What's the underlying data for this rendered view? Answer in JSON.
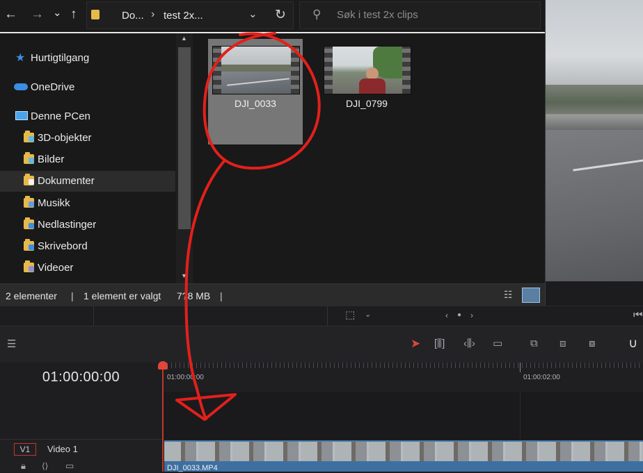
{
  "explorer": {
    "address": {
      "crumbs": [
        "Do...",
        "test 2x..."
      ],
      "separator": "›"
    },
    "search_placeholder": "Søk i test 2x clips",
    "nav": {
      "items": [
        {
          "label": "Hurtigtilgang",
          "icon": "star-icon",
          "level": 0
        },
        {
          "label": "OneDrive",
          "icon": "cloud-icon",
          "level": 0
        },
        {
          "label": "Denne PCen",
          "icon": "computer-icon",
          "level": 0
        },
        {
          "label": "3D-objekter",
          "icon": "folder-3d-icon",
          "level": 1
        },
        {
          "label": "Bilder",
          "icon": "folder-pictures-icon",
          "level": 1
        },
        {
          "label": "Dokumenter",
          "icon": "folder-documents-icon",
          "level": 1,
          "selected": true
        },
        {
          "label": "Musikk",
          "icon": "folder-music-icon",
          "level": 1
        },
        {
          "label": "Nedlastinger",
          "icon": "folder-downloads-icon",
          "level": 1
        },
        {
          "label": "Skrivebord",
          "icon": "folder-desktop-icon",
          "level": 1
        },
        {
          "label": "Videoer",
          "icon": "folder-videos-icon",
          "level": 1
        }
      ]
    },
    "files": [
      {
        "name": "DJI_0033",
        "selected": true
      },
      {
        "name": "DJI_0799",
        "selected": false
      }
    ],
    "status": {
      "count": "2 elementer",
      "selection": "1 element er valgt",
      "size": "7?8 MB"
    }
  },
  "resolve": {
    "timecode": "01:00:00:00",
    "ruler_labels": [
      "01:00:00:00",
      "01:00:02:00"
    ],
    "track": {
      "badge": "V1",
      "name": "Video 1"
    },
    "clip_name": "DJI_0033.MP4"
  },
  "colors": {
    "accent_red": "#e0473a",
    "clip_blue": "#3d6fa1",
    "folder_yellow": "#e6b94a",
    "annotation_red": "#e3201b"
  }
}
